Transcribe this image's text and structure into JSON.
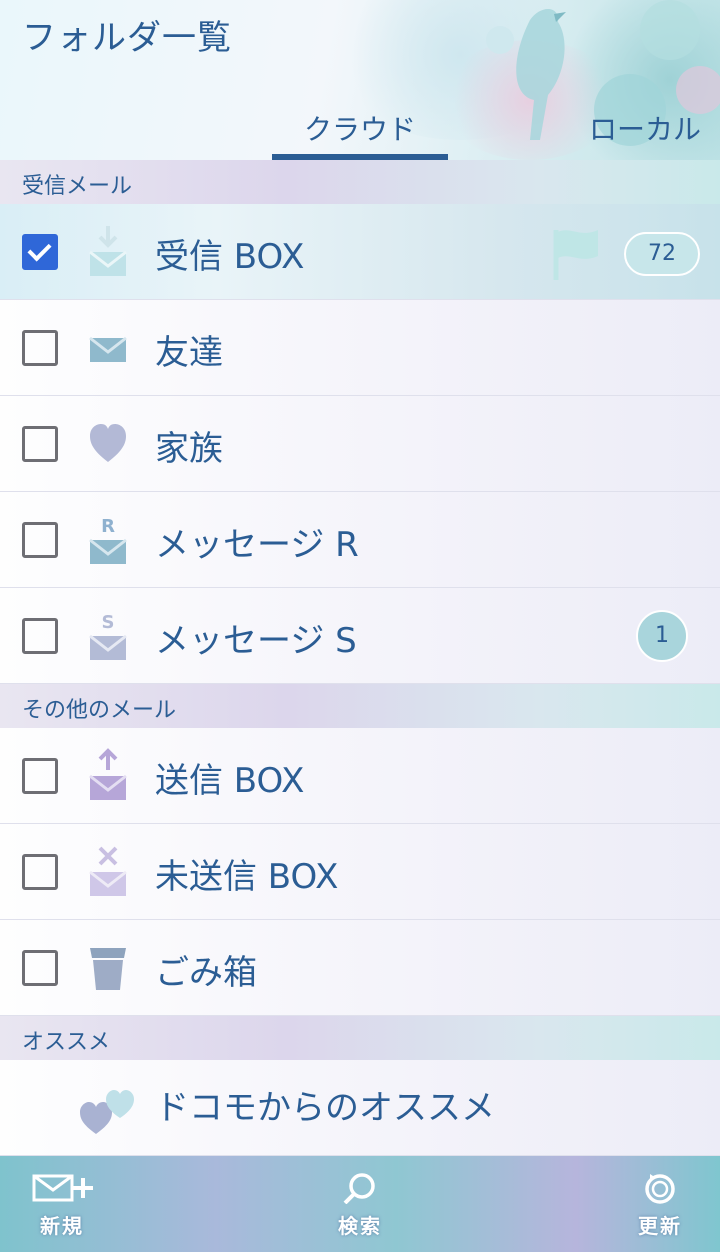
{
  "header": {
    "title": "フォルダ一覧",
    "tabs": [
      {
        "label": "クラウド",
        "active": true
      },
      {
        "label": "ローカル",
        "active": false
      }
    ]
  },
  "sections": {
    "inbox_mail": "受信メール",
    "other_mail": "その他のメール",
    "recommend": "オススメ"
  },
  "folders": {
    "inbox": {
      "label": "受信 BOX",
      "checked": true,
      "badge": "72",
      "icon": "inbox-download-icon"
    },
    "friends": {
      "label": "友達",
      "checked": false,
      "icon": "envelope-icon"
    },
    "family": {
      "label": "家族",
      "checked": false,
      "icon": "heart-icon"
    },
    "message_r": {
      "label": "メッセージ R",
      "checked": false,
      "icon": "envelope-r-icon",
      "icon_letter": "R"
    },
    "message_s": {
      "label": "メッセージ S",
      "checked": false,
      "badge": "1",
      "icon": "envelope-s-icon",
      "icon_letter": "S"
    },
    "sent": {
      "label": "送信 BOX",
      "checked": false,
      "icon": "outbox-upload-icon"
    },
    "unsent": {
      "label": "未送信 BOX",
      "checked": false,
      "icon": "envelope-x-icon"
    },
    "trash": {
      "label": "ごみ箱",
      "checked": false,
      "icon": "trash-icon"
    },
    "docomo": {
      "label": "ドコモからのオススメ",
      "icon": "double-heart-icon"
    }
  },
  "toolbar": {
    "new_label": "新規",
    "search_label": "検索",
    "refresh_label": "更新"
  },
  "colors": {
    "accent": "#2b5d94",
    "checkbox_checked": "#2f67d8",
    "badge_bg": "#c7e6ea"
  }
}
